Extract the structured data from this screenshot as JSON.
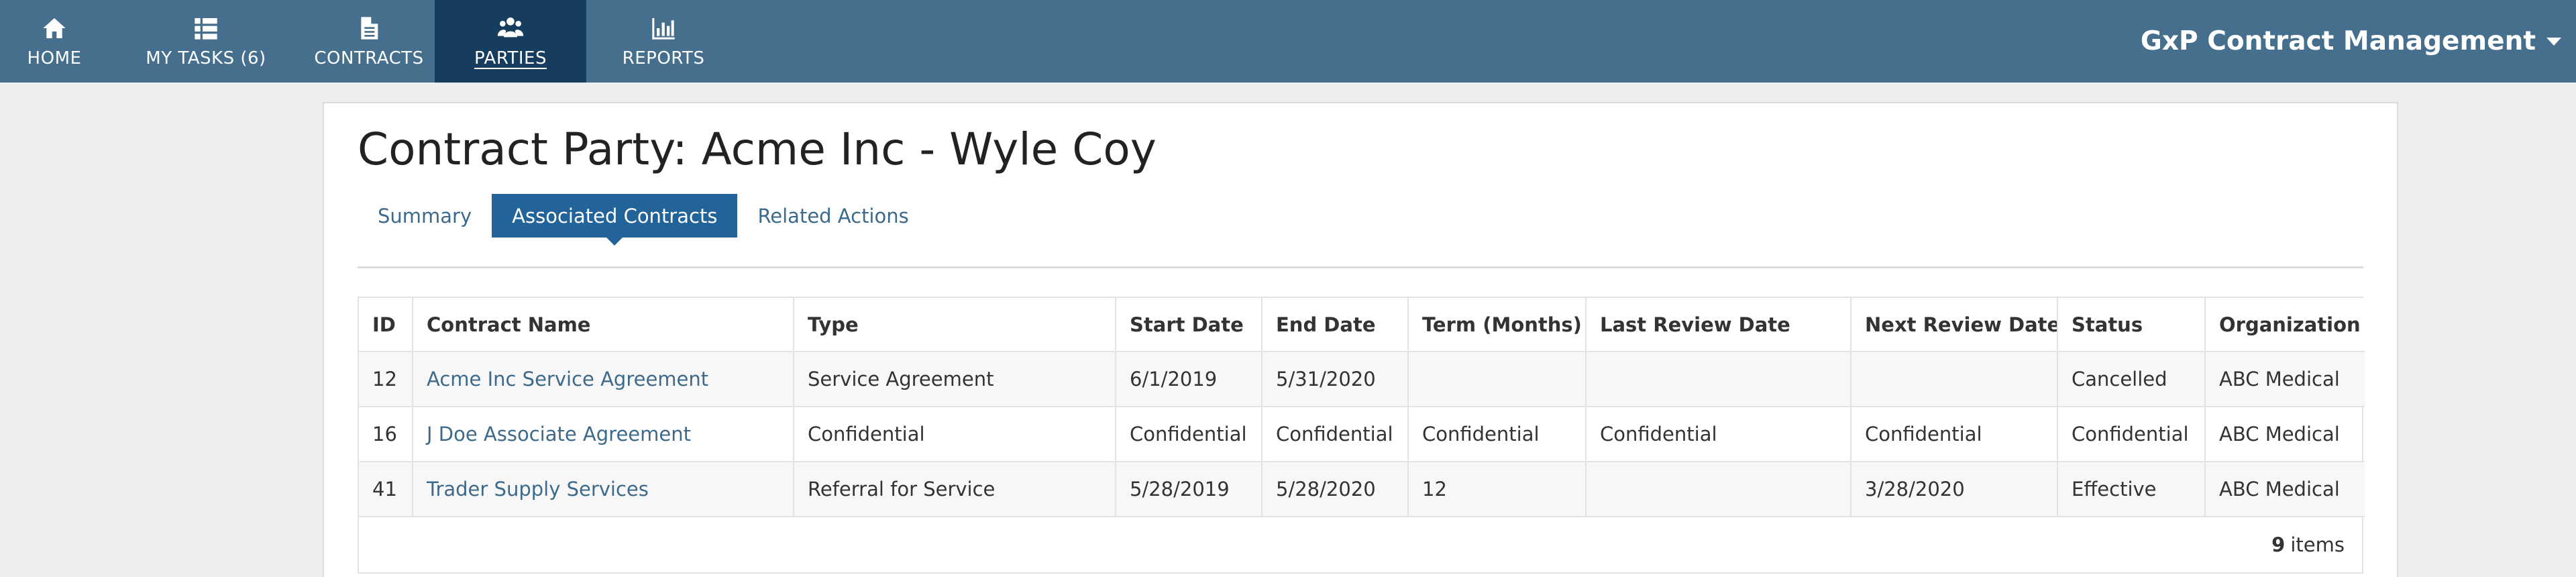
{
  "nav": {
    "items": [
      {
        "label": "HOME",
        "icon": "home-icon"
      },
      {
        "label": "MY TASKS (6)",
        "icon": "list-icon"
      },
      {
        "label": "CONTRACTS",
        "icon": "document-icon"
      },
      {
        "label": "PARTIES",
        "icon": "users-icon",
        "active": true
      },
      {
        "label": "REPORTS",
        "icon": "bar-chart-icon"
      }
    ],
    "brand": "GxP Contract Management"
  },
  "page": {
    "title": "Contract Party: Acme Inc - Wyle Coy"
  },
  "tabs": [
    {
      "label": "Summary"
    },
    {
      "label": "Associated Contracts",
      "active": true
    },
    {
      "label": "Related Actions"
    }
  ],
  "table": {
    "columns": [
      "ID",
      "Contract Name",
      "Type",
      "Start Date",
      "End Date",
      "Term (Months)",
      "Last Review Date",
      "Next Review Date",
      "Status",
      "Organization"
    ],
    "rows": [
      [
        "12",
        "Acme Inc Service Agreement",
        "Service Agreement",
        "6/1/2019",
        "5/31/2020",
        "",
        "",
        "",
        "Cancelled",
        "ABC Medical"
      ],
      [
        "16",
        "J Doe Associate Agreement",
        "Confidential",
        "Confidential",
        "Confidential",
        "Confidential",
        "Confidential",
        "Confidential",
        "Confidential",
        "ABC Medical"
      ],
      [
        "41",
        "Trader Supply Services",
        "Referral for Service",
        "5/28/2019",
        "5/28/2020",
        "12",
        "",
        "3/28/2020",
        "Effective",
        "ABC Medical"
      ]
    ],
    "footer": {
      "count": "9",
      "label": "items"
    }
  },
  "colors": {
    "navbar": "#466f8e",
    "nav_active": "#163d5e",
    "tab_active": "#22639a",
    "link": "#3d6a8b"
  }
}
